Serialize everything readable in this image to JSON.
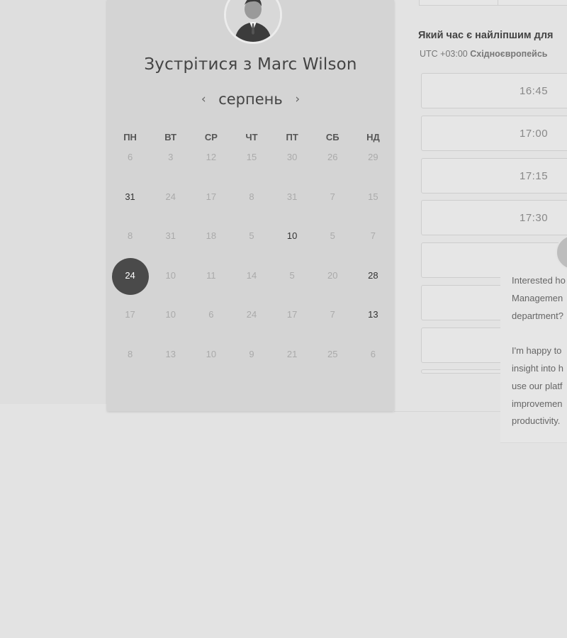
{
  "scheduler": {
    "title": "Зустрітися з Marc Wilson",
    "month": "серпень",
    "prev_icon": "‹",
    "next_icon": "›",
    "weekdays": [
      "ПН",
      "ВТ",
      "СР",
      "ЧТ",
      "ПТ",
      "СБ",
      "НД"
    ],
    "weeks": [
      [
        "6",
        "3",
        "12",
        "15",
        "30",
        "26",
        "29"
      ],
      [
        "31",
        "24",
        "17",
        "8",
        "31",
        "7",
        "15"
      ],
      [
        "8",
        "31",
        "18",
        "5",
        "10",
        "5",
        "7"
      ],
      [
        "24",
        "10",
        "11",
        "14",
        "5",
        "20",
        "28"
      ],
      [
        "17",
        "10",
        "6",
        "24",
        "17",
        "7",
        "13"
      ],
      [
        "8",
        "13",
        "10",
        "9",
        "21",
        "25",
        "6"
      ]
    ],
    "selected_day": "24"
  },
  "time_panel": {
    "question": "Який час є найліпшим для",
    "timezone_prefix": "UTC +03:00",
    "timezone_name": "Східноєвропейсь",
    "slots": [
      "16:45",
      "17:00",
      "17:15",
      "17:30",
      "",
      "",
      "",
      ""
    ]
  },
  "chat": {
    "lines": [
      "Interested ho",
      "Managemen",
      "department?",
      "",
      "I'm happy to",
      "insight into h",
      "use our platf",
      "improvemen",
      "productivity."
    ]
  }
}
